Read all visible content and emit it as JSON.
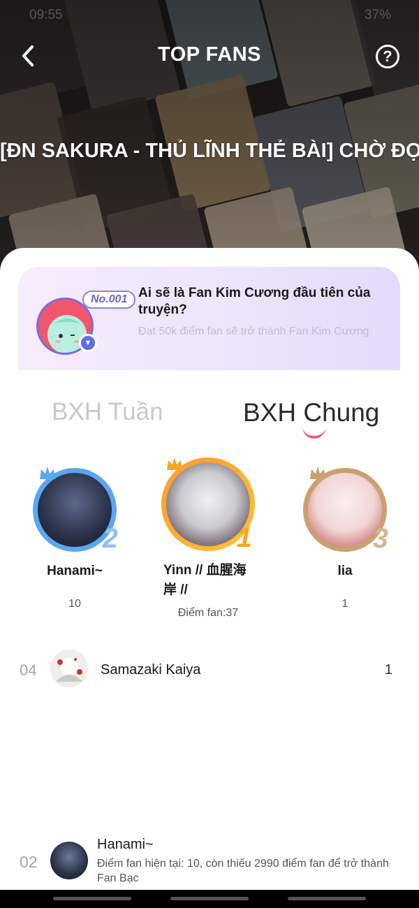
{
  "status_bar": {
    "time": "09:55",
    "battery": "37%"
  },
  "header": {
    "title": "TOP FANS",
    "story_title": "[ĐN SAKURA - THỦ LĨNH THẺ BÀI] CHỜ ĐỢI"
  },
  "banner": {
    "badge": "No.001",
    "title": "Ai sẽ là Fan Kim Cương đầu tiên của truyện?",
    "subtitle": "Đạt 50k điểm fan sẽ trở thành Fan Kim Cương"
  },
  "tabs": {
    "weekly": "BXH Tuần",
    "overall": "BXH Chung",
    "active": "overall"
  },
  "podium": [
    {
      "rank": "2",
      "name": "Hanami~",
      "score": "10",
      "ring_color": "#5aa7f0"
    },
    {
      "rank": "1",
      "name": "Yinn // 血腥海岸 //",
      "score": "Điểm fan:37",
      "ring_color": "#f5a623"
    },
    {
      "rank": "3",
      "name": "lia",
      "score": "1",
      "ring_color": "#c9a170"
    }
  ],
  "list": [
    {
      "rank": "04",
      "name": "Samazaki Kaiya",
      "score": "1"
    }
  ],
  "me": {
    "rank": "02",
    "name": "Hanami~",
    "detail": "Điểm fan hiện tại: 10, còn thiếu 2990 điểm fan để trở thành Fan Bạc"
  }
}
